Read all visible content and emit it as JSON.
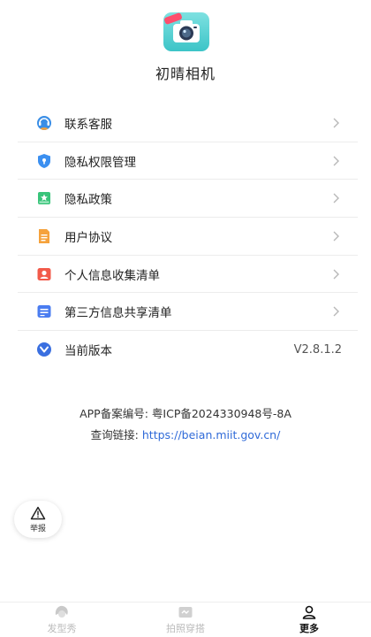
{
  "app": {
    "name": "初晴相机"
  },
  "menu": {
    "items": [
      {
        "label": "联系客服",
        "icon": "customer-service-icon",
        "color": "#3a8ee6"
      },
      {
        "label": "隐私权限管理",
        "icon": "shield-icon",
        "color": "#3b8ff0"
      },
      {
        "label": "隐私政策",
        "icon": "bookmark-icon",
        "color": "#39c47a"
      },
      {
        "label": "用户协议",
        "icon": "document-icon",
        "color": "#f5a23c"
      },
      {
        "label": "个人信息收集清单",
        "icon": "person-icon",
        "color": "#f25a4a"
      },
      {
        "label": "第三方信息共享清单",
        "icon": "list-icon",
        "color": "#4a7cf0"
      },
      {
        "label": "当前版本",
        "icon": "version-icon",
        "color": "#3a6fe0"
      }
    ],
    "version": "V2.8.1.2"
  },
  "footer": {
    "record_label": "APP备案编号:",
    "record_number": "粤ICP备2024330948号-8A",
    "query_label": "查询链接:",
    "query_link": "https://beian.miit.gov.cn/"
  },
  "report": {
    "label": "举报"
  },
  "tabbar": {
    "tabs": [
      {
        "label": "发型秀",
        "icon": "hair-icon"
      },
      {
        "label": "拍照穿搭",
        "icon": "photo-outfit-icon"
      },
      {
        "label": "更多",
        "icon": "user-icon"
      }
    ]
  }
}
